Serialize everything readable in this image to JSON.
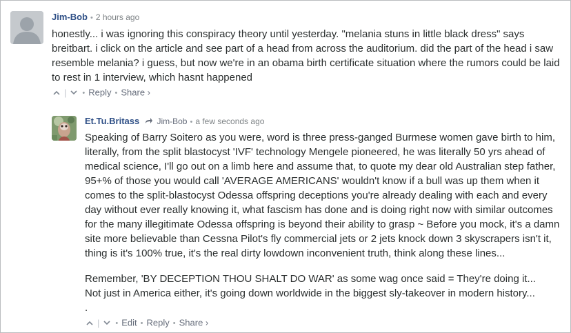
{
  "comments": [
    {
      "author": "Jim-Bob",
      "time": "2 hours ago",
      "paragraphs": [
        "honestly... i was ignoring this conspiracy theory until yesterday. \"melania stuns in little black dress\" says breitbart. i click on the article and see part of a head from across the auditorium. did the part of the head i saw resemble melania? i guess, but now we're in an obama birth certificate situation where the rumors could be laid to rest in 1 interview, which hasnt happened"
      ],
      "actions": {
        "reply": "Reply",
        "share": "Share ›"
      }
    },
    {
      "author": "Et.Tu.Britass",
      "in_reply_to": "Jim-Bob",
      "time": "a few seconds ago",
      "paragraphs": [
        "Speaking of Barry Soitero as you were, word is three press-ganged Burmese women gave birth to him, literally, from the split blastocyst 'IVF' technology Mengele pioneered, he was literally 50 yrs ahead of medical science, I'll go out on a limb here and assume that, to quote my dear old Australian step father, 95+% of those you would call 'AVERAGE AMERICANS' wouldn't know if a bull was up them when it comes to the split-blastocyst Odessa offspring deceptions you're already dealing with each and every day without ever really knowing it, what fascism has done and is doing right now with similar outcomes for the many illegitimate Odessa offspring is beyond their ability to grasp ~ Before you mock, it's a damn site more believable than Cessna Pilot's fly commercial jets or 2 jets knock down 3 skyscrapers isn't it, thing is it's 100% true, it's the real dirty lowdown inconvenient truth, think along these lines...",
        "Remember, 'BY DECEPTION THOU SHALT DO WAR' as some wag once said = They're doing it...",
        "Not just in America either, it's going down worldwide in the biggest sly-takeover in modern history...",
        "."
      ],
      "actions": {
        "edit": "Edit",
        "reply": "Reply",
        "share": "Share ›"
      }
    }
  ],
  "icons": {
    "upvote": "chevron-up-icon",
    "downvote": "chevron-down-icon",
    "reply_arrow": "reply-arrow-icon"
  },
  "colors": {
    "author": "#2e4f86",
    "muted": "#656c7a",
    "text": "#2a2e2e",
    "border": "#b9bcbf"
  }
}
